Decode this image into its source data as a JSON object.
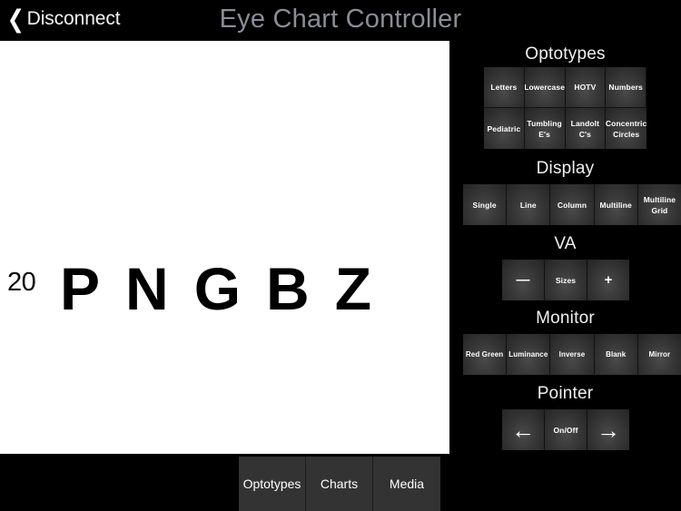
{
  "titlebar": {
    "back_label": "Disconnect",
    "back_icon": "chevron-left-icon",
    "title": "Eye Chart Controller"
  },
  "chart": {
    "va_label": "20",
    "optotypes": [
      "P",
      "N",
      "G",
      "B",
      "Z"
    ],
    "background": "#ffffff",
    "glyph_color": "#000000"
  },
  "panel": {
    "background": "#000000",
    "button_color": "#3a3a3a",
    "sections": [
      {
        "title": "Optotypes",
        "buttons": [
          "Letters",
          "Lowercase",
          "HOTV",
          "Numbers",
          "Pediatric",
          "Tumbling E's",
          "Landolt C's",
          "Concentric Circles"
        ]
      },
      {
        "title": "Display",
        "buttons": [
          "Single",
          "Line",
          "Column",
          "Multiline",
          "Multiline Grid"
        ]
      },
      {
        "title": "VA",
        "buttons": [
          "—",
          "Sizes",
          "+"
        ],
        "icons": [
          "minus-icon",
          null,
          "plus-icon"
        ]
      },
      {
        "title": "Monitor",
        "buttons": [
          "Red Green",
          "Luminance",
          "Inverse",
          "Blank",
          "Mirror"
        ]
      },
      {
        "title": "Pointer",
        "buttons": [
          "←",
          "On/Off",
          "→"
        ],
        "icons": [
          "arrow-left-icon",
          null,
          "arrow-right-icon"
        ]
      }
    ]
  },
  "tabbar": {
    "tabs": [
      "Optotypes",
      "Charts",
      "Media"
    ]
  }
}
